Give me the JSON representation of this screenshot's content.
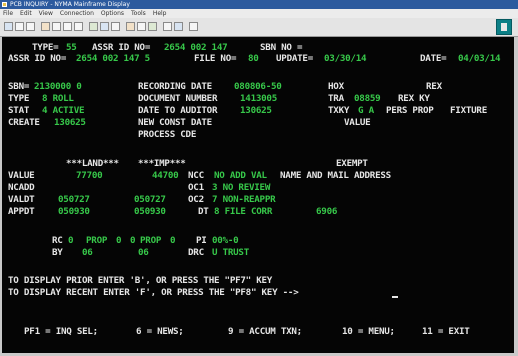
{
  "window": {
    "title": "PCB INQUIRY - NYMA Mainframe Display",
    "menu": [
      "File",
      "Edit",
      "View",
      "Connection",
      "Options",
      "Tools",
      "Help"
    ]
  },
  "header": {
    "type_label": "TYPE=",
    "type": "55",
    "assr_id_label": "ASSR ID NO=",
    "assr_id": "2654 002 147",
    "sbn_label": "SBN NO =",
    "assr_id2_label": "ASSR ID NO=",
    "assr_id2": "2654 002 147 5",
    "file_no_label": "FILE NO=",
    "file_no": "80",
    "update_label": "UPDATE=",
    "update": "03/30/14",
    "date_label": "DATE=",
    "date": "04/03/14"
  },
  "record": {
    "sbn_label": "SBN=",
    "sbn": "2130000 0",
    "recording_date_label": "RECORDING DATE",
    "recording_date": "080806-50",
    "hox_label": "HOX",
    "rex_label": "REX",
    "type_label": "TYPE",
    "type": "8 ROLL",
    "document_number_label": "DOCUMENT NUMBER",
    "document_number": "1413005",
    "tra_label": "TRA",
    "tra": "08859",
    "rex_ky_label": "REX KY",
    "stat_label": "STAT",
    "stat": "4 ACTIVE",
    "date_to_auditor_label": "DATE TO AUDITOR",
    "date_to_auditor": "130625",
    "txky_label": "TXKY",
    "txky": "G A",
    "pers_prop_label": "PERS PROP",
    "fixture_label": "FIXTURE",
    "create_label": "CREATE",
    "create": "130625",
    "new_const_date_label": "NEW CONST DATE",
    "value_label": "VALUE",
    "process_cde_label": "PROCESS CDE"
  },
  "values": {
    "land_header": "***LAND***",
    "imp_header": "***IMP***",
    "exempt_label": "EXEMPT",
    "value_label": "VALUE",
    "land_value": "77700",
    "imp_value": "44700",
    "ncc_label": "NCC",
    "ncc": "NO ADD VAL",
    "name_address_label": "NAME AND MAIL ADDRESS",
    "ncadd_label": "NCADD",
    "oc1_label": "OC1",
    "oc1": "3 NO REVIEW",
    "valdt_label": "VALDT",
    "valdt_land": "050727",
    "valdt_imp": "050727",
    "oc2_label": "OC2",
    "oc2": "7 NON-REAPPR",
    "appdt_label": "APPDT",
    "appdt_land": "050930",
    "appdt_imp": "050930",
    "dt_label": "DT",
    "dt": "8 FILE CORR",
    "dt_code": "6906"
  },
  "codes": {
    "rc_label": "RC",
    "rc": "0",
    "prop_label": "PROP",
    "prop1": "0",
    "prop2_prefix": "0",
    "prop2": "0",
    "pi_label": "PI",
    "pi": "00%-0",
    "by_label": "BY",
    "by1": "06",
    "by2": "06",
    "drc_label": "DRC",
    "drc": "U TRUST"
  },
  "instructions": {
    "line1": "TO DISPLAY PRIOR ENTER 'B', OR PRESS THE \"PF7\" KEY",
    "line2": "TO DISPLAY RECENT ENTER 'F', OR PRESS THE \"PF8\" KEY -->"
  },
  "fkeys": [
    {
      "label": "PF1 = INQ SEL;"
    },
    {
      "label": "6 = NEWS;"
    },
    {
      "label": "9 = ACCUM TXN;"
    },
    {
      "label": "10 = MENU;"
    },
    {
      "label": "11 = EXIT"
    }
  ],
  "colors": {
    "screen_bg": "#050505",
    "label_text": "#e6e6e6",
    "field_text": "#37c84a",
    "titlebar": "#2c5a9e"
  }
}
